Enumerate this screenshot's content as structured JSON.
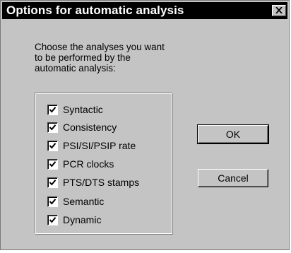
{
  "dialog": {
    "title": "Options for automatic analysis",
    "prompt_lines": [
      "Choose the analyses you want",
      "to be performed by the",
      "automatic analysis:"
    ],
    "options": [
      {
        "label": "Syntactic",
        "checked": true
      },
      {
        "label": "Consistency",
        "checked": true
      },
      {
        "label": "PSI/SI/PSIP rate",
        "checked": true
      },
      {
        "label": "PCR clocks",
        "checked": true
      },
      {
        "label": "PTS/DTS stamps",
        "checked": true
      },
      {
        "label": "Semantic",
        "checked": true
      },
      {
        "label": "Dynamic",
        "checked": true
      }
    ],
    "ok_label": "OK",
    "cancel_label": "Cancel"
  },
  "icons": {
    "close": "close-icon",
    "check": "checkmark-icon"
  },
  "colors": {
    "face": "#c4c4c4",
    "titlebar": "#000000",
    "title_text": "#ffffff"
  }
}
